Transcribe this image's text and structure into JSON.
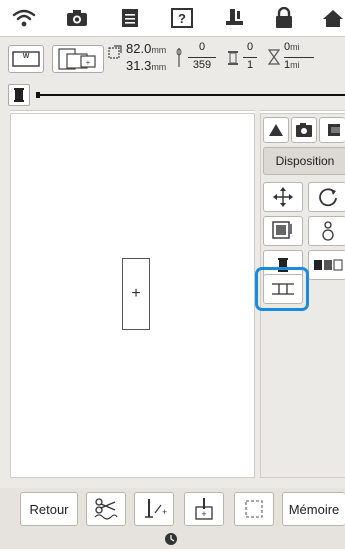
{
  "info": {
    "width_value": "82.0",
    "height_value": "31.3",
    "unit": "mm",
    "stitch_current": "0",
    "stitch_total": "359",
    "color_current": "0",
    "color_total": "1",
    "time_current": "0",
    "time_total": "1",
    "time_unit": "mi"
  },
  "panel": {
    "tab_label": "Disposition"
  },
  "design": {
    "center_mark": "+"
  },
  "toolbar": {
    "back_label": "Retour",
    "memory_label": "Mémoire"
  },
  "colors": {
    "highlight": "#1a8be0",
    "panel_bg": "#eceae6"
  }
}
